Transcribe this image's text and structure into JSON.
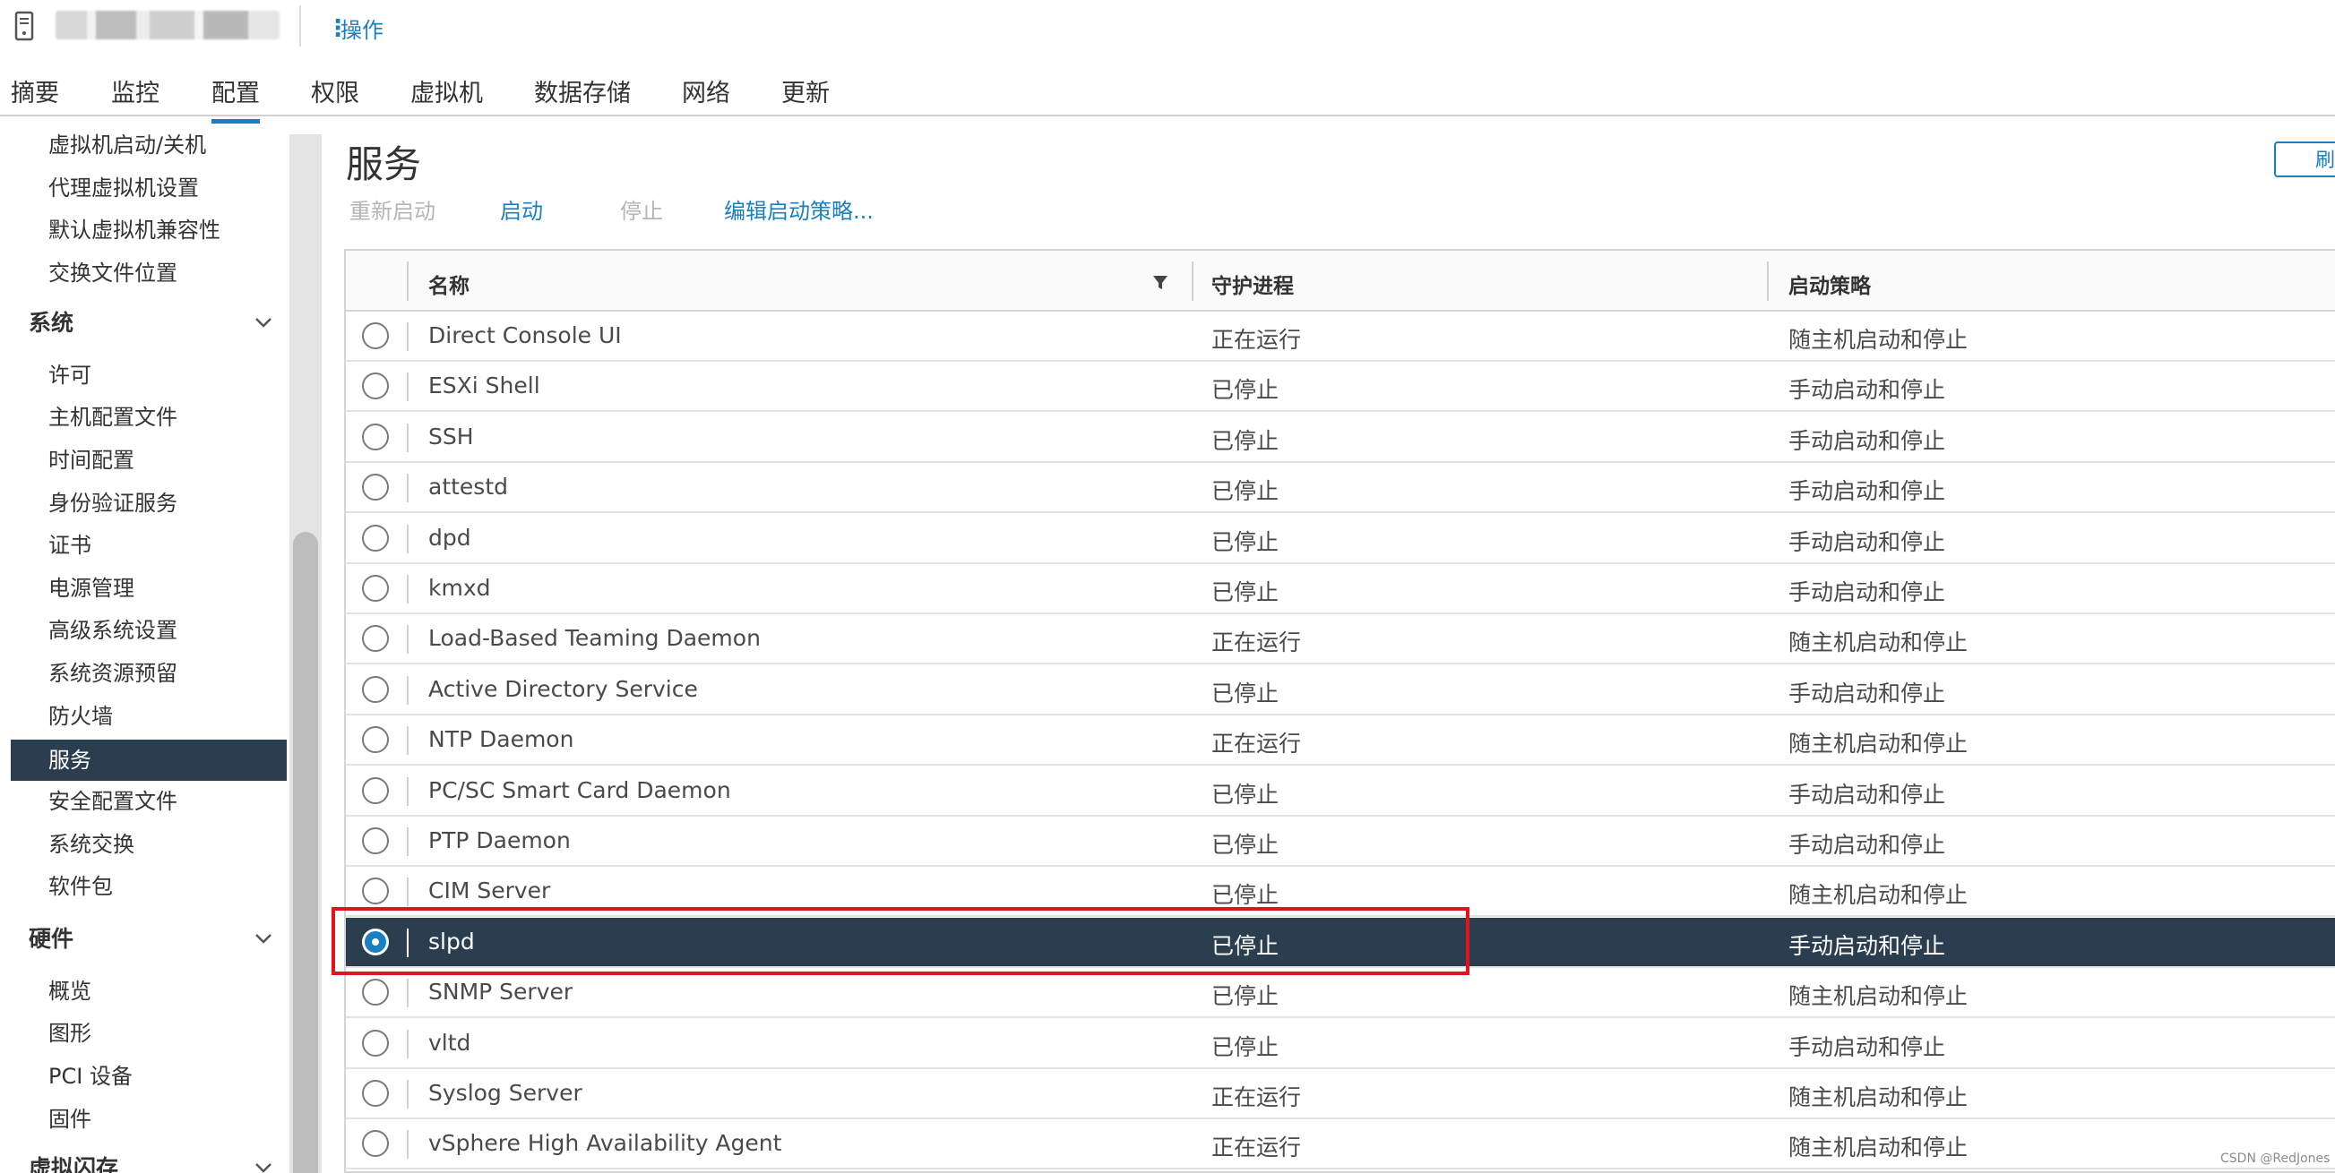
{
  "header": {
    "actions_label": "操作"
  },
  "tabs": [
    {
      "label": "摘要",
      "active": false
    },
    {
      "label": "监控",
      "active": false
    },
    {
      "label": "配置",
      "active": true
    },
    {
      "label": "权限",
      "active": false
    },
    {
      "label": "虚拟机",
      "active": false
    },
    {
      "label": "数据存储",
      "active": false
    },
    {
      "label": "网络",
      "active": false
    },
    {
      "label": "更新",
      "active": false
    }
  ],
  "sidebar": {
    "vm_items": [
      "虚拟机启动/关机",
      "代理虚拟机设置",
      "默认虚拟机兼容性",
      "交换文件位置"
    ],
    "system_group": "系统",
    "system_items": [
      "许可",
      "主机配置文件",
      "时间配置",
      "身份验证服务",
      "证书",
      "电源管理",
      "高级系统设置",
      "系统资源预留",
      "防火墙",
      "服务",
      "安全配置文件",
      "系统交换",
      "软件包"
    ],
    "selected_item": "服务",
    "hardware_group": "硬件",
    "hardware_items": [
      "概览",
      "图形",
      "PCI 设备",
      "固件"
    ],
    "next_group": "虚拟闪存"
  },
  "main": {
    "title": "服务",
    "refresh_label": "刷",
    "toolbar": {
      "restart": "重新启动",
      "start": "启动",
      "stop": "停止",
      "edit_policy": "编辑启动策略..."
    },
    "columns": {
      "name": "名称",
      "daemon": "守护进程",
      "policy": "启动策略"
    },
    "rows": [
      {
        "name": "Direct Console UI",
        "daemon": "正在运行",
        "policy": "随主机启动和停止"
      },
      {
        "name": "ESXi Shell",
        "daemon": "已停止",
        "policy": "手动启动和停止"
      },
      {
        "name": "SSH",
        "daemon": "已停止",
        "policy": "手动启动和停止"
      },
      {
        "name": "attestd",
        "daemon": "已停止",
        "policy": "手动启动和停止"
      },
      {
        "name": "dpd",
        "daemon": "已停止",
        "policy": "手动启动和停止"
      },
      {
        "name": "kmxd",
        "daemon": "已停止",
        "policy": "手动启动和停止"
      },
      {
        "name": "Load-Based Teaming Daemon",
        "daemon": "正在运行",
        "policy": "随主机启动和停止"
      },
      {
        "name": "Active Directory Service",
        "daemon": "已停止",
        "policy": "手动启动和停止"
      },
      {
        "name": "NTP Daemon",
        "daemon": "正在运行",
        "policy": "随主机启动和停止"
      },
      {
        "name": "PC/SC Smart Card Daemon",
        "daemon": "已停止",
        "policy": "手动启动和停止"
      },
      {
        "name": "PTP Daemon",
        "daemon": "已停止",
        "policy": "手动启动和停止"
      },
      {
        "name": "CIM Server",
        "daemon": "已停止",
        "policy": "随主机启动和停止"
      },
      {
        "name": "slpd",
        "daemon": "已停止",
        "policy": "手动启动和停止",
        "selected": true
      },
      {
        "name": "SNMP Server",
        "daemon": "已停止",
        "policy": "随主机启动和停止"
      },
      {
        "name": "vltd",
        "daemon": "已停止",
        "policy": "手动启动和停止"
      },
      {
        "name": "Syslog Server",
        "daemon": "正在运行",
        "policy": "随主机启动和停止"
      },
      {
        "name": "vSphere High Availability Agent",
        "daemon": "正在运行",
        "policy": "随主机启动和停止"
      }
    ]
  },
  "watermark": "CSDN @RedJones",
  "colors": {
    "accent": "#1a7fc1",
    "selected_row": "#2b3e4f",
    "highlight": "#e3131b"
  }
}
